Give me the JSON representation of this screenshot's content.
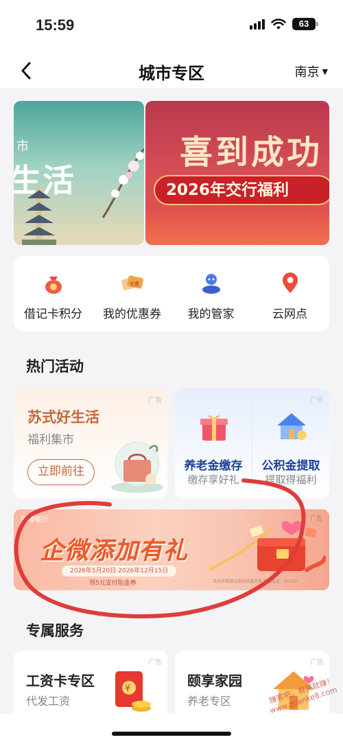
{
  "status_bar": {
    "time": "15:59",
    "battery": "63"
  },
  "nav": {
    "title": "城市专区",
    "city": "南京"
  },
  "banner": {
    "left": {
      "line1": "市",
      "line2": "生活"
    },
    "right": {
      "headline": "喜到成功",
      "subline": "2026年交行福利"
    }
  },
  "quick_menu": [
    {
      "label": "借记卡积分",
      "icon": "money-bag-icon"
    },
    {
      "label": "我的优惠券",
      "icon": "coupon-icon"
    },
    {
      "label": "我的管家",
      "icon": "butler-icon"
    },
    {
      "label": "云网点",
      "icon": "location-pin-icon"
    }
  ],
  "hot_section": {
    "title": "热门活动"
  },
  "activity_left": {
    "ad": "广告",
    "title": "苏式好生活",
    "subtitle": "福利集市",
    "button": "立即前往"
  },
  "activity_right": {
    "ad": "广告",
    "items": [
      {
        "title": "养老金缴存",
        "subtitle": "缴存享好礼"
      },
      {
        "title": "公积金提取",
        "subtitle": "提取得福利"
      }
    ]
  },
  "promo": {
    "bank": "交通银行",
    "ad": "广告",
    "headline": "企微添加有礼",
    "date_range": "2026年5月20日-2026年12月15日",
    "coupon": "领5元支付贴金券",
    "terms": "活动详情请以活动页面为准 客服电话：95559"
  },
  "service_section": {
    "title": "专属服务"
  },
  "services": [
    {
      "ad": "广告",
      "title": "工资卡专区",
      "subtitle": "代发工资"
    },
    {
      "ad": "广告",
      "title": "颐享家园",
      "subtitle": "养老专区"
    }
  ],
  "watermark": {
    "line1": "赚客吧，有奖就赚！",
    "line2": "www.zuanke8.com"
  },
  "colors": {
    "accent_red": "#e03c3c",
    "brand_blue": "#1c3f99",
    "warm_orange": "#c4683b"
  }
}
